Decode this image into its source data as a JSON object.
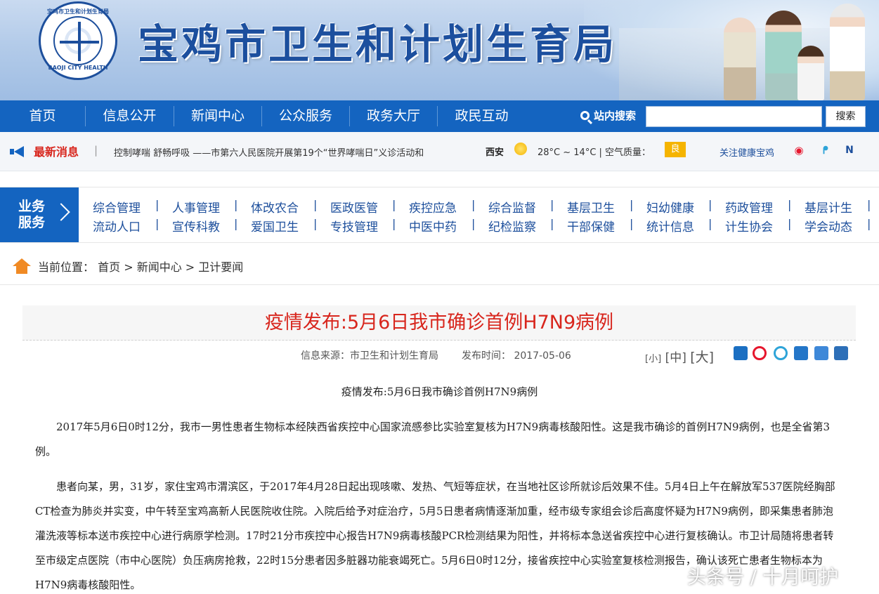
{
  "header": {
    "site_title": "宝鸡市卫生和计划生育局",
    "logo_top": "宝鸡市卫生和计划生育局",
    "logo_bottom": "BAOJI CITY HEALTH"
  },
  "nav": {
    "items": [
      "首页",
      "信息公开",
      "新闻中心",
      "公众服务",
      "政务大厅",
      "政民互动"
    ],
    "search_label": "站内搜索",
    "search_button": "搜索",
    "search_value": ""
  },
  "ticker": {
    "label": "最新消息",
    "separator": "|",
    "headline": "控制哮喘 舒畅呼吸 ——市第六人民医院开展第19个“世界哮喘日”义诊活动和",
    "city": "西安",
    "temperature": "28°C ~ 14°C  |  空气质量：",
    "air_quality": "良",
    "follow": "关注健康宝鸡",
    "icons": [
      "weibo-icon",
      "tencent-weibo-icon",
      "netease-news-icon"
    ]
  },
  "business": {
    "tag": "业务服务",
    "row1": [
      "综合管理",
      "人事管理",
      "体改农合",
      "医政医管",
      "疾控应急",
      "综合监督",
      "基层卫生",
      "妇幼健康",
      "药政管理",
      "基层计生"
    ],
    "row2": [
      "流动人口",
      "宣传科教",
      "爱国卫生",
      "专技管理",
      "中医中药",
      "纪检监察",
      "干部保健",
      "统计信息",
      "计生协会",
      "学会动态"
    ]
  },
  "breadcrumb": {
    "label": "当前位置：",
    "path": "首页 > 新闻中心 > 卫计要闻"
  },
  "article": {
    "title": "疫情发布:5月6日我市确诊首例H7N9病例",
    "source": "信息来源：市卫生和计划生育局",
    "date": "发布时间： 2017-05-06",
    "font_small": "[小]",
    "font_medium": "[中]",
    "font_large": "[大]",
    "share_icons": [
      "add-share-icon",
      "weibo-share-icon",
      "qzone-share-icon",
      "news-share-icon",
      "copy-share-icon",
      "print-icon"
    ],
    "subhead": "疫情发布:5月6日我市确诊首例H7N9病例",
    "paragraphs": [
      "2017年5月6日0时12分，我市一男性患者生物标本经陕西省疾控中心国家流感参比实验室复核为H7N9病毒核酸阳性。这是我市确诊的首例H7N9病例，也是全省第3例。",
      "患者向某，男，31岁，家住宝鸡市渭滨区，于2017年4月28日起出现咳嗽、发热、气短等症状，在当地社区诊所就诊后效果不佳。5月4日上午在解放军537医院经胸部CT检查为肺炎并实变，中午转至宝鸡高新人民医院收住院。入院后给予对症治疗，5月5日患者病情逐渐加重，经市级专家组会诊后高度怀疑为H7N9病例，即采集患者肺泡灌洗液等标本送市疾控中心进行病原学检测。17时21分市疾控中心报告H7N9病毒核酸PCR检测结果为阳性，并将标本急送省疾控中心进行复核确认。市卫计局随将患者转至市级定点医院（市中心医院）负压病房抢救，22时15分患者因多脏器功能衰竭死亡。5月6日0时12分，接省疾控中心实验室复核检测报告，确认该死亡患者生物标本为H7N9病毒核酸阳性。"
    ]
  },
  "watermark": "头条号 / 十月呵护",
  "colors": {
    "nav_blue": "#1464c0",
    "title_red": "#d8261d",
    "link_blue": "#1d4f9c",
    "aqi_yellow": "#f5b400"
  }
}
